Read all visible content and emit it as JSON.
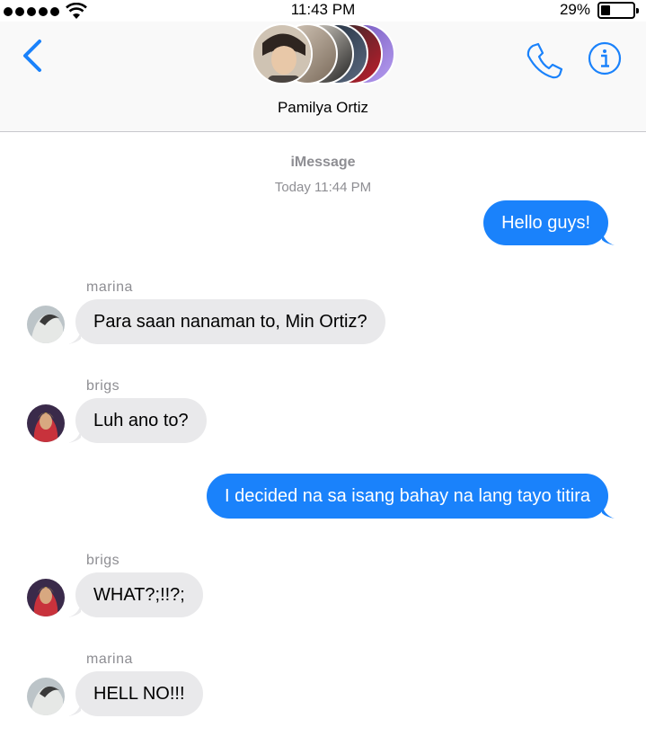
{
  "status_bar": {
    "time": "11:43 PM",
    "battery_percent": "29%",
    "battery_level": 0.29,
    "signal_icon": "signal-dots-icon",
    "wifi_icon": "wifi-icon"
  },
  "header": {
    "group_name": "Pamilya Ortiz",
    "back_icon": "chevron-left-icon",
    "call_icon": "phone-icon",
    "info_icon": "info-icon"
  },
  "thread": {
    "service": "iMessage",
    "timestamp": "Today 11:44 PM"
  },
  "messages": [
    {
      "direction": "outgoing",
      "text": "Hello guys!"
    },
    {
      "direction": "incoming",
      "sender": "marina",
      "text": "Para saan nanaman to, Min Ortiz?"
    },
    {
      "direction": "incoming",
      "sender": "brigs",
      "text": "Luh ano to?"
    },
    {
      "direction": "outgoing",
      "text": "I decided na sa isang bahay na lang tayo titira"
    },
    {
      "direction": "incoming",
      "sender": "brigs",
      "text": "WHAT?;!!?;"
    },
    {
      "direction": "incoming",
      "sender": "marina",
      "text": "HELL NO!!!"
    }
  ],
  "colors": {
    "accent": "#1a82fb",
    "incoming_bubble": "#e9e9eb",
    "secondary_text": "#8e8e93"
  }
}
